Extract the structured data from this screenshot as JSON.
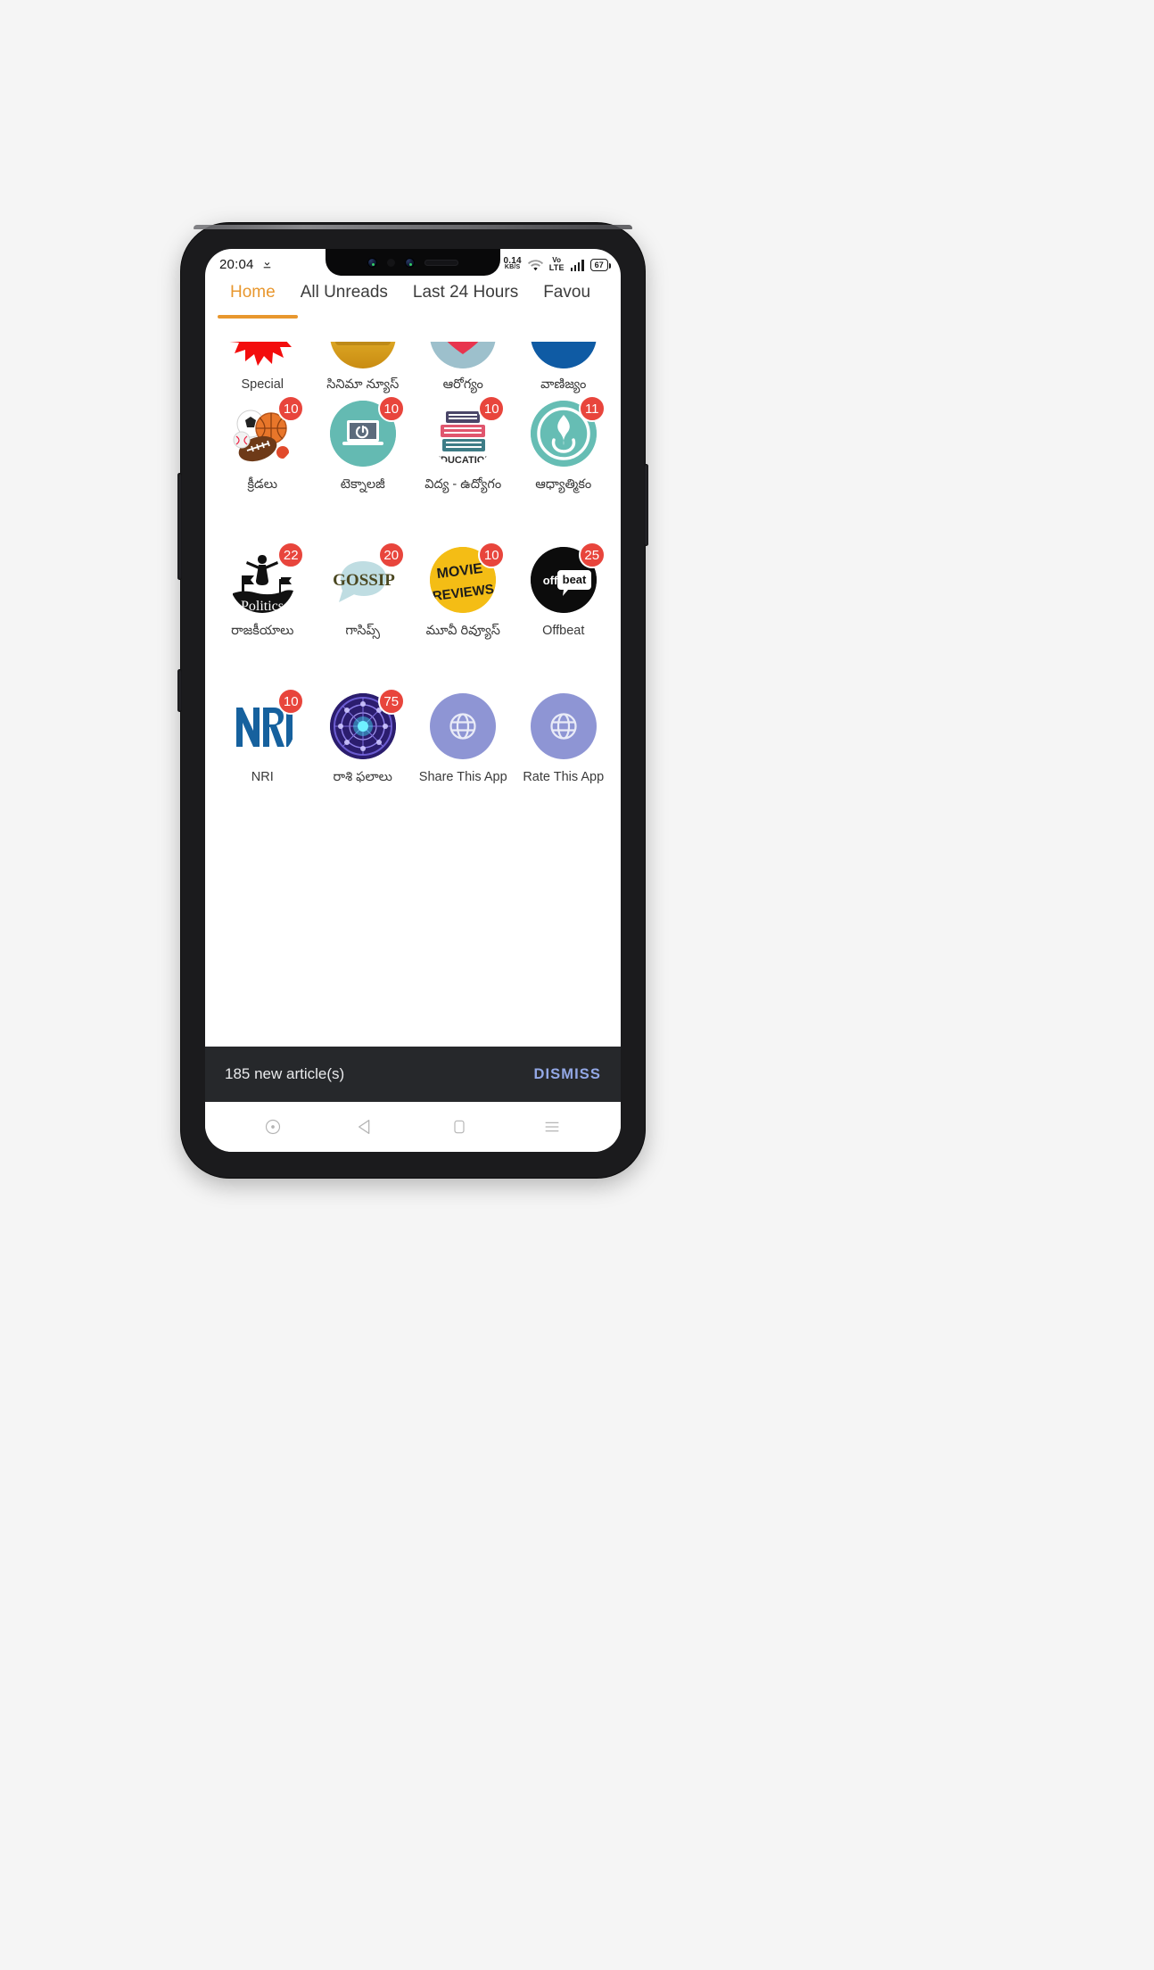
{
  "status_bar": {
    "time": "20:04",
    "download_icon": "download-icon",
    "alarm_icon": "alarm-icon",
    "net_speed_value": "0.14",
    "net_speed_unit": "KB/S",
    "wifi_icon": "wifi-icon",
    "volte_top": "Vo",
    "volte_bottom": "LTE",
    "signal_icon": "signal-bars-icon",
    "battery_level": "67"
  },
  "tabs": [
    {
      "label": "Home",
      "active": true
    },
    {
      "label": "All Unreads",
      "active": false
    },
    {
      "label": "Last 24 Hours",
      "active": false
    },
    {
      "label": "Favou",
      "active": false
    }
  ],
  "accent_color": "#e8972e",
  "badge_color": "#e8453c",
  "grid": {
    "row1": [
      {
        "label": "Special",
        "icon": "red-starburst-icon",
        "badge": ""
      },
      {
        "label": "సినిమా న్యూస్",
        "icon": "gold-film-icon",
        "badge": ""
      },
      {
        "label": "ఆరోగ్యం",
        "icon": "health-heart-icon",
        "badge": ""
      },
      {
        "label": "వాణిజ్యం",
        "icon": "business-blue-icon",
        "badge": ""
      }
    ],
    "row2": [
      {
        "label": "క్రీడలు",
        "icon": "sports-balls-icon",
        "badge": "10"
      },
      {
        "label": "టెక్నాలజీ",
        "icon": "laptop-power-icon",
        "badge": "10"
      },
      {
        "label": "విద్య - ఉద్యోగం",
        "icon": "education-books-icon",
        "badge": "10"
      },
      {
        "label": "ఆధ్యాత్మికం",
        "icon": "spiritual-ribbon-icon",
        "badge": "11"
      }
    ],
    "row3": [
      {
        "label": "రాజకీయాలు",
        "icon": "politics-icon",
        "badge": "22"
      },
      {
        "label": "గాసిప్స్",
        "icon": "gossip-icon",
        "badge": "20"
      },
      {
        "label": "మూవీ రివ్యూస్",
        "icon": "movie-reviews-icon",
        "badge": "10"
      },
      {
        "label": "Offbeat",
        "icon": "offbeat-icon",
        "badge": "25"
      }
    ],
    "row4": [
      {
        "label": "NRI",
        "icon": "nri-icon",
        "badge": "10"
      },
      {
        "label": "రాశి ఫలాలు",
        "icon": "zodiac-wheel-icon",
        "badge": "75"
      },
      {
        "label": "Share This App",
        "icon": "globe-icon",
        "badge": ""
      },
      {
        "label": "Rate This App",
        "icon": "globe-icon",
        "badge": ""
      }
    ]
  },
  "snackbar": {
    "message": "185 new article(s)",
    "action": "DISMISS"
  },
  "nav_bar": {
    "items": [
      {
        "name": "assistant-circle-icon"
      },
      {
        "name": "back-icon"
      },
      {
        "name": "home-icon"
      },
      {
        "name": "recents-menu-icon"
      }
    ]
  }
}
